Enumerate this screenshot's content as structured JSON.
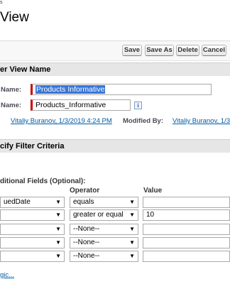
{
  "header": {
    "pre_title": "s",
    "title": "View"
  },
  "toolbar": {
    "save": "Save",
    "save_as": "Save As",
    "delete": "Delete",
    "cancel": "Cancel"
  },
  "view_name_section": {
    "heading": "er View Name",
    "name_label": "Name:",
    "name_value": "Products Informative",
    "unique_label": "Name:",
    "unique_value": "Products_Informative",
    "info_icon": "i",
    "created_by": "Vitaliy Buranov, 1/3/2019 4:24 PM",
    "modified_label": "Modified By:",
    "modified_by": "Vitaliy Buranov, 1/3"
  },
  "filter_section": {
    "heading": "cify Filter Criteria",
    "additional_fields": "ditional Fields (Optional):",
    "col_operator": "Operator",
    "col_value": "Value",
    "rows": [
      {
        "field": "uedDate",
        "operator": "equals",
        "value": ""
      },
      {
        "field": "",
        "operator": "greater or equal",
        "value": "10"
      },
      {
        "field": "",
        "operator": "--None--",
        "value": ""
      },
      {
        "field": "",
        "operator": "--None--",
        "value": ""
      },
      {
        "field": "",
        "operator": "--None--",
        "value": ""
      }
    ],
    "logic_link": "gic..."
  },
  "icons": {
    "dropdown": "▼"
  }
}
